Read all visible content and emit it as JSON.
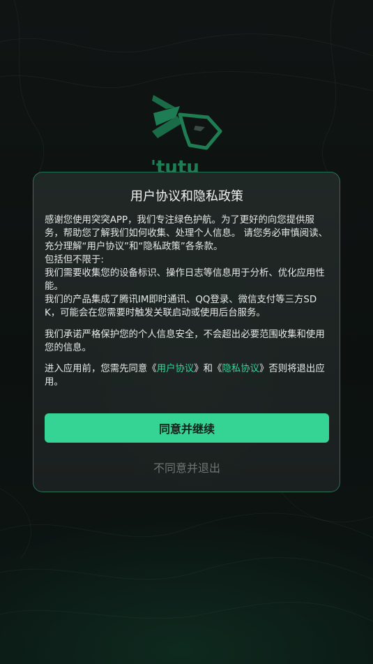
{
  "brand": {
    "logo_text": "'tutu",
    "accent": "#34d399"
  },
  "dialog": {
    "title": "用户协议和隐私政策",
    "paragraph1": "感谢您使用突突APP，我们专注绿色护航。为了更好的向您提供服务，帮助您了解我们如何收集、处理个人信息。 请您务必审慎阅读、充分理解“用户协议”和“隐私政策”各条款。\n包括但不限于:\n我们需要收集您的设备标识、操作日志等信息用于分析、优化应用性能。\n我们的产品集成了腾讯IM即时通讯、QQ登录、微信支付等三方SDK，可能会在您需要时触发关联启动或使用后台服务。",
    "paragraph2": "我们承诺严格保护您的个人信息安全，不会超出必要范围收集和使用您的信息。",
    "paragraph3": {
      "prefix": "进入应用前，您需先同意《",
      "user_agreement_link": "用户协议",
      "middle": "》和《",
      "privacy_link": "隐私协议",
      "suffix": "》否则将退出应用。"
    },
    "agree_button": "同意并继续",
    "disagree_button": "不同意并退出"
  }
}
